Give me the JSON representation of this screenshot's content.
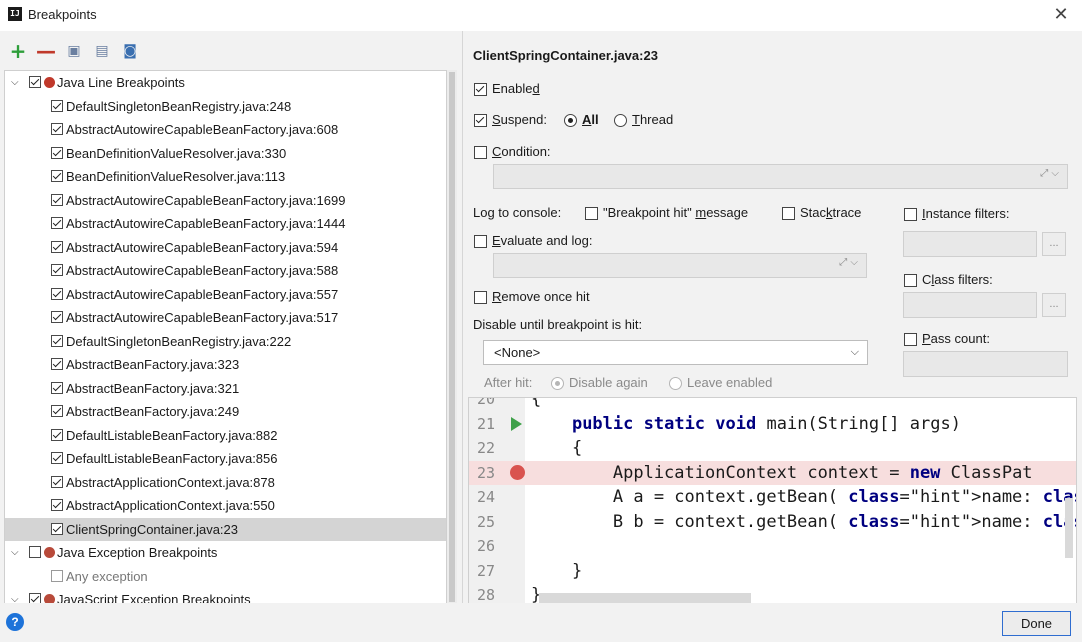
{
  "window": {
    "title": "Breakpoints",
    "app_icon": "IJ",
    "close_glyph": "✕"
  },
  "toolbar": [
    {
      "name": "add-button",
      "icon": "plus-icon",
      "glyph": "+",
      "color": "#2e9e3a"
    },
    {
      "name": "remove-button",
      "icon": "minus-icon",
      "glyph": "—",
      "color": "#c0392b"
    },
    {
      "name": "group-by-file-button",
      "icon": "folder-group-icon",
      "glyph": "▣",
      "color": "#6a7fa0"
    },
    {
      "name": "group-by-package-button",
      "icon": "package-group-icon",
      "glyph": "▤",
      "color": "#6a7fa0"
    },
    {
      "name": "group-by-class-button",
      "icon": "class-group-icon",
      "glyph": "◙",
      "color": "#3a6fb0"
    }
  ],
  "tree": {
    "java_line": {
      "label": "Java Line Breakpoints",
      "checked": true
    },
    "items": [
      {
        "label": "DefaultSingletonBeanRegistry.java:248"
      },
      {
        "label": "AbstractAutowireCapableBeanFactory.java:608"
      },
      {
        "label": "BeanDefinitionValueResolver.java:330"
      },
      {
        "label": "BeanDefinitionValueResolver.java:113"
      },
      {
        "label": "AbstractAutowireCapableBeanFactory.java:1699"
      },
      {
        "label": "AbstractAutowireCapableBeanFactory.java:1444"
      },
      {
        "label": "AbstractAutowireCapableBeanFactory.java:594"
      },
      {
        "label": "AbstractAutowireCapableBeanFactory.java:588"
      },
      {
        "label": "AbstractAutowireCapableBeanFactory.java:557"
      },
      {
        "label": "AbstractAutowireCapableBeanFactory.java:517"
      },
      {
        "label": "DefaultSingletonBeanRegistry.java:222"
      },
      {
        "label": "AbstractBeanFactory.java:323"
      },
      {
        "label": "AbstractBeanFactory.java:321"
      },
      {
        "label": "AbstractBeanFactory.java:249"
      },
      {
        "label": "DefaultListableBeanFactory.java:882"
      },
      {
        "label": "DefaultListableBeanFactory.java:856"
      },
      {
        "label": "AbstractApplicationContext.java:878"
      },
      {
        "label": "AbstractApplicationContext.java:550"
      },
      {
        "label": "ClientSpringContainer.java:23",
        "selected": true
      }
    ],
    "java_exception": {
      "label": "Java Exception Breakpoints",
      "checked": false
    },
    "any_exception": {
      "label": "Any exception",
      "checked": false
    },
    "js_exception": {
      "label": "JavaScript Exception Breakpoints"
    }
  },
  "details": {
    "header": "ClientSpringContainer.java:23",
    "enabled": {
      "label_pre": "Enable",
      "label_u": "d",
      "label_post": "",
      "checked": true
    },
    "suspend": {
      "label_pre": "",
      "label_u": "S",
      "label_post": "uspend:",
      "checked": true
    },
    "suspend_all": {
      "label_pre": "",
      "label_u": "A",
      "label_post": "ll",
      "selected": true
    },
    "suspend_thread": {
      "label_pre": "",
      "label_u": "T",
      "label_post": "hread",
      "selected": false
    },
    "condition": {
      "label_pre": "",
      "label_u": "C",
      "label_post": "ondition:",
      "checked": false
    },
    "log_to_console": "Log to console:",
    "bp_hit_message": {
      "label_pre": "\"Breakpoint hit\" ",
      "label_u": "m",
      "label_post": "essage",
      "checked": false
    },
    "stacktrace": {
      "label_pre": "Stac",
      "label_u": "k",
      "label_post": "trace",
      "checked": false
    },
    "evaluate_and_log": {
      "label_pre": "",
      "label_u": "E",
      "label_post": "valuate and log:",
      "checked": false
    },
    "remove_once_hit": {
      "label_pre": "",
      "label_u": "R",
      "label_post": "emove once hit",
      "checked": false
    },
    "disable_until": "Disable until breakpoint is hit:",
    "disable_until_value": "<None>",
    "after_hit": "After hit:",
    "disable_again": {
      "label": "Disable again",
      "selected": true
    },
    "leave_enabled": {
      "label": "Leave enabled",
      "selected": false
    },
    "instance_filters": {
      "label_pre": "",
      "label_u": "I",
      "label_post": "nstance filters:",
      "checked": false
    },
    "class_filters": {
      "label_pre": "C",
      "label_u": "l",
      "label_post": "ass filters:",
      "checked": false
    },
    "pass_count": {
      "label_pre": "",
      "label_u": "P",
      "label_post": "ass count:",
      "checked": false
    },
    "browse_glyph": "..."
  },
  "editor": {
    "lines": [
      {
        "num": "20",
        "text": "{"
      },
      {
        "num": "21",
        "text": "    public static void main(String[] args)"
      },
      {
        "num": "22",
        "text": "    {"
      },
      {
        "num": "23",
        "text": "        ApplicationContext context = new ClassPat"
      },
      {
        "num": "24",
        "text": "        A a = context.getBean( name: \"a\", A.class)"
      },
      {
        "num": "25",
        "text": "        B b = context.getBean( name: \"b\", B.class)"
      },
      {
        "num": "26",
        "text": ""
      },
      {
        "num": "27",
        "text": "    }"
      },
      {
        "num": "28",
        "text": "}"
      }
    ],
    "highlight_line": "23",
    "run_marker_line": "21"
  },
  "footer": {
    "help_glyph": "?",
    "done_label": "Done"
  },
  "colors": {
    "breakpoint": "#d9534f",
    "highlight": "#f7dede",
    "keyword": "#000080",
    "string": "#067d17",
    "accent": "#2f6dd0"
  }
}
